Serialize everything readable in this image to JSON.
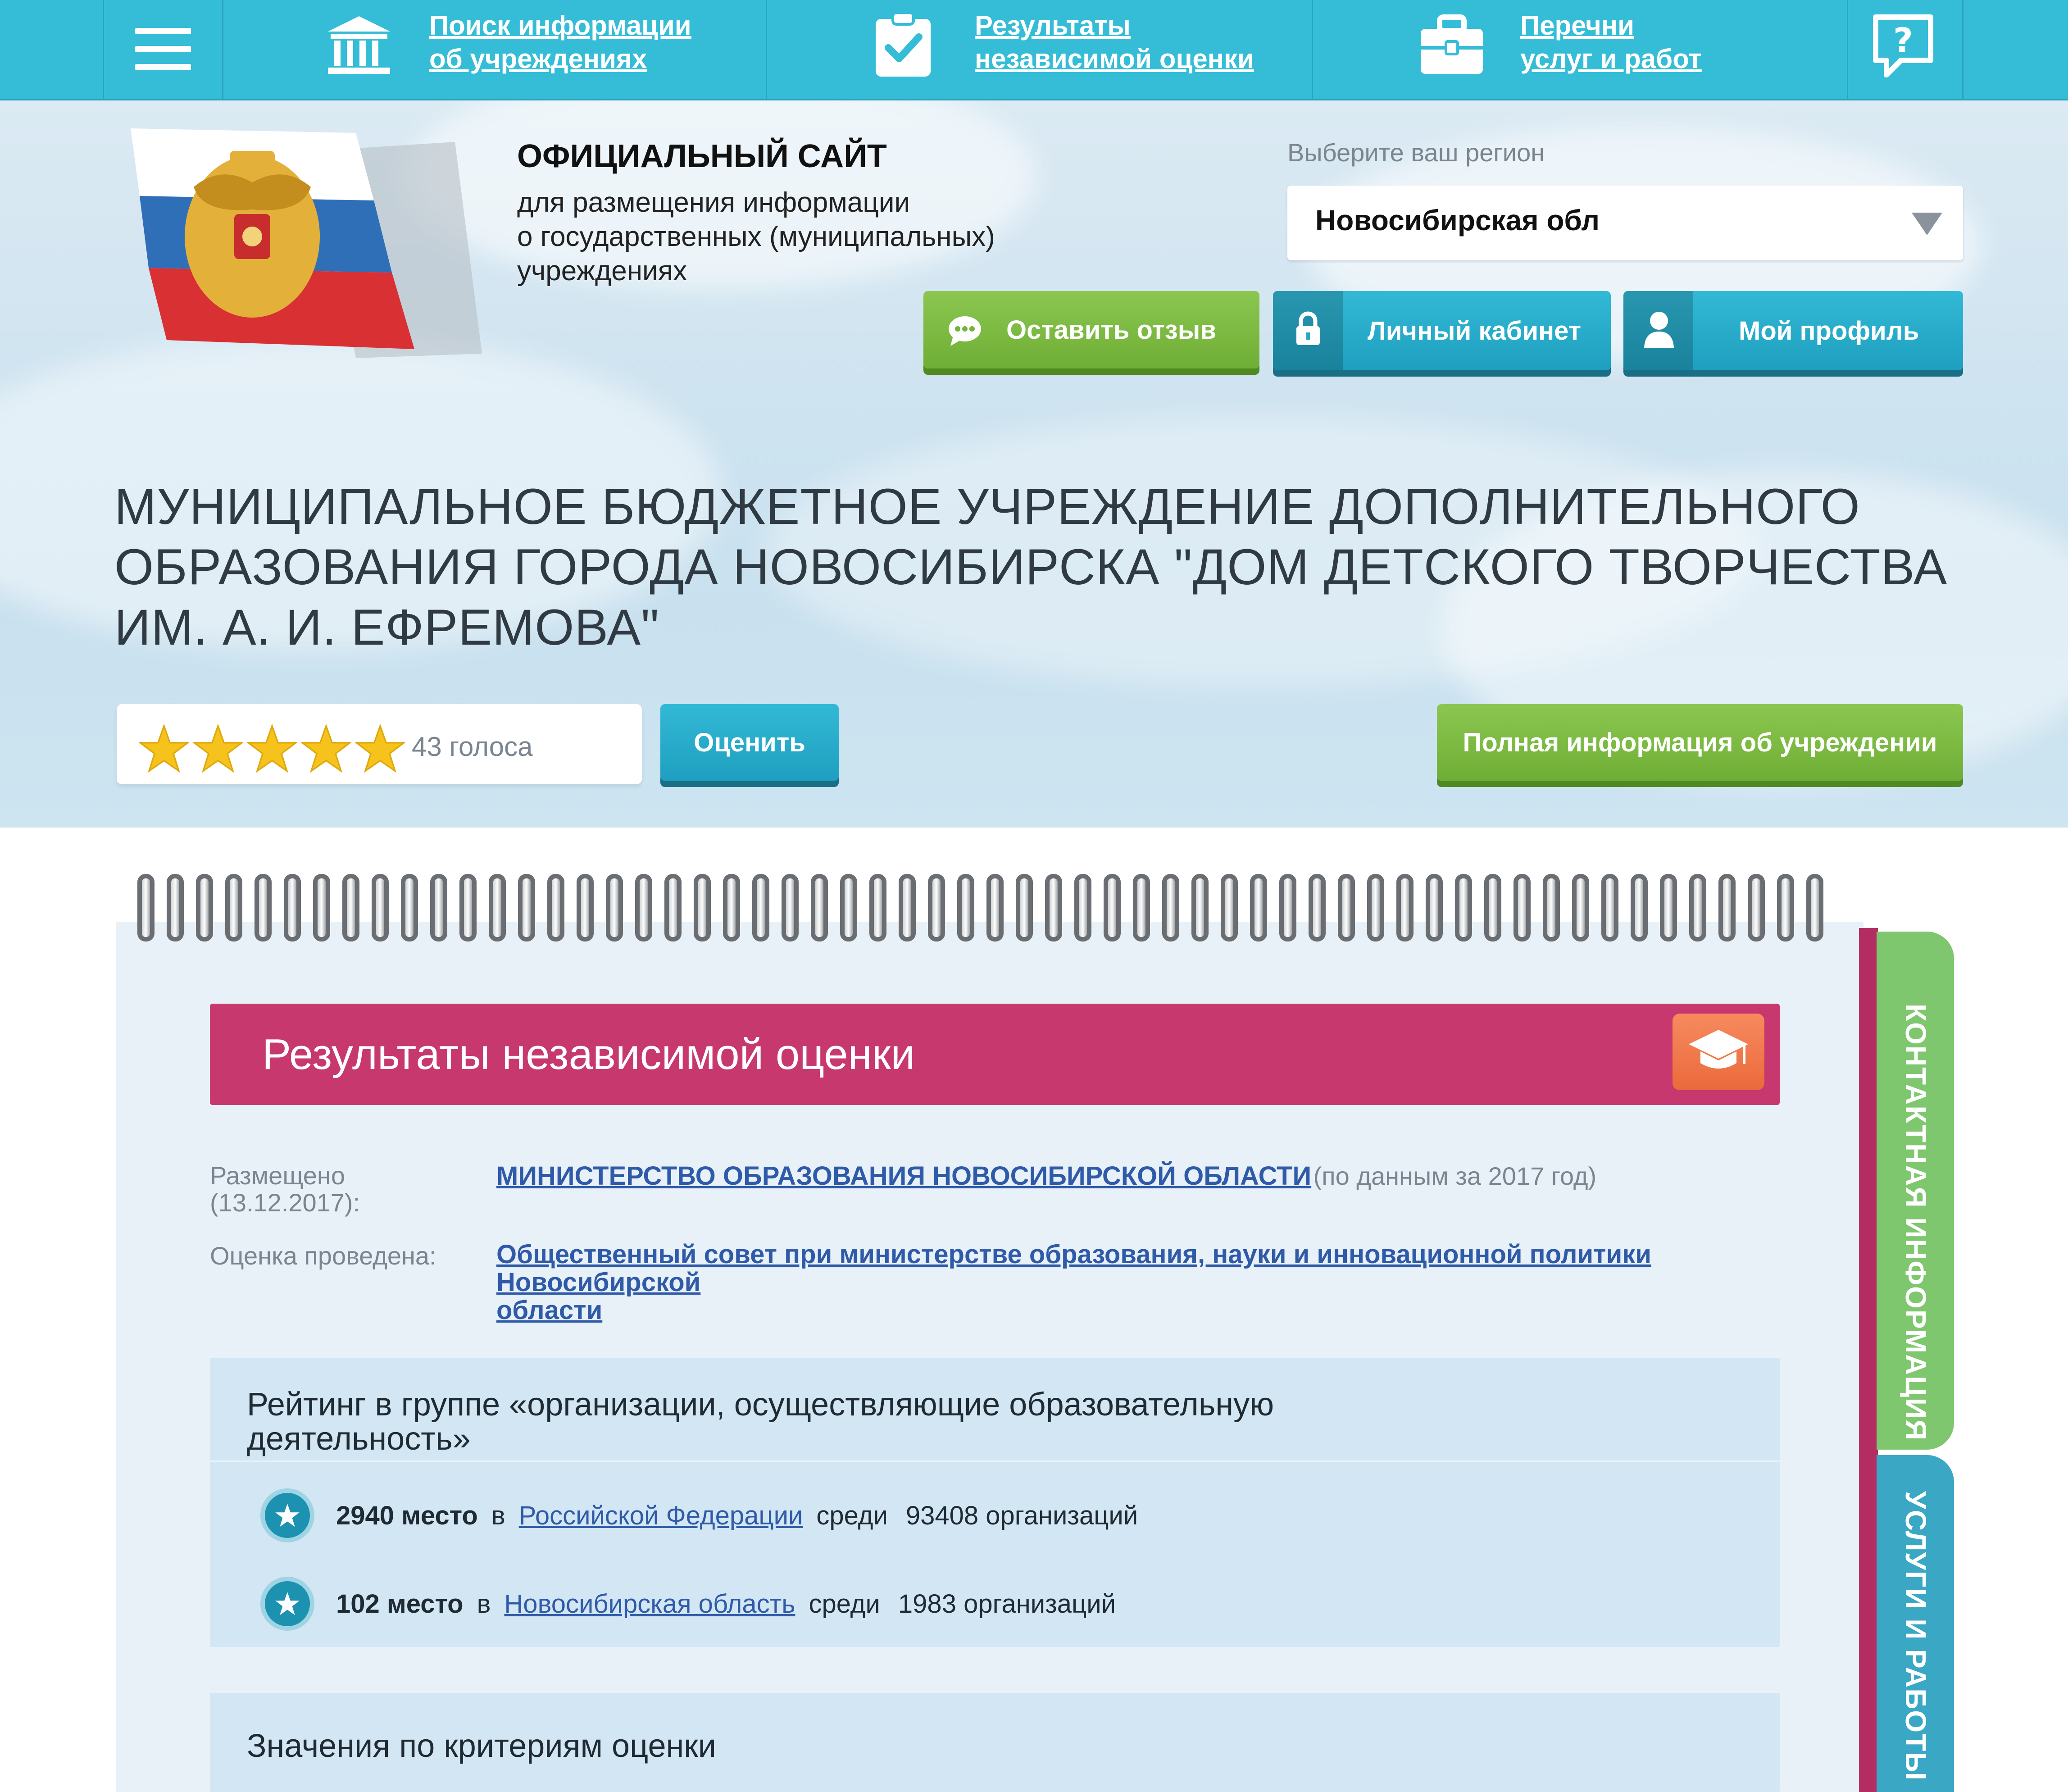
{
  "nav": {
    "search_line1": "Поиск информации",
    "search_line2": "об учреждениях",
    "results_line1": "Результаты",
    "results_line2": "независимой оценки",
    "lists_line1": "Перечни",
    "lists_line2": "услуг и работ",
    "icons": [
      "menu-icon",
      "institution-icon",
      "checklist-icon",
      "briefcase-icon",
      "help-chat-icon"
    ]
  },
  "header": {
    "site_title": "ОФИЦИАЛЬНЫЙ САЙТ",
    "site_sub_line1": "для размещения информации",
    "site_sub_line2": "о государственных (муниципальных)",
    "site_sub_line3": "учреждениях",
    "region_label": "Выберите ваш регион",
    "region_value": "Новосибирская обл",
    "feedback_button": "Оставить отзыв",
    "cabinet_button": "Личный кабинет",
    "profile_button": "Мой профиль"
  },
  "org": {
    "title_line1": "МУНИЦИПАЛЬНОЕ БЮДЖЕТНОЕ УЧРЕЖДЕНИЕ ДОПОЛНИТЕЛЬНОГО",
    "title_line2": "ОБРАЗОВАНИЯ ГОРОДА НОВОСИБИРСКА \"ДОМ ДЕТСКОГО ТВОРЧЕСТВА",
    "title_line3": "ИМ. А. И. ЕФРЕМОВА\"",
    "stars_filled": 5,
    "stars_total": 5,
    "votes": "43 голоса",
    "rate_button": "Оценить",
    "full_info_button": "Полная информация об учреждении"
  },
  "results": {
    "title": "Результаты независимой оценки",
    "posted_label_line1": "Размещено",
    "posted_label_line2": "(13.12.2017):",
    "posted_link": "МИНИСТЕРСТВО ОБРАЗОВАНИЯ НОВОСИБИРСКОЙ ОБЛАСТИ",
    "posted_note": "(по данным за 2017 год)",
    "assessed_label": "Оценка проведена:",
    "assessed_link_line1": "Общественный совет при министерстве образования, науки и инновационной политики Новосибирской",
    "assessed_link_line2": "области"
  },
  "rating": {
    "title_line1": "Рейтинг в группе «организации, осуществляющие образовательную",
    "title_line2": "деятельность»",
    "rows": [
      {
        "place": "2940 место",
        "in": "в",
        "region": "Российской Федерации",
        "among": "среди",
        "count": "93408 организаций"
      },
      {
        "place": "102 место",
        "in": "в",
        "region": "Новосибирская область",
        "among": "среди",
        "count": "1983 организаций"
      }
    ]
  },
  "criteria": {
    "title": "Значения по критериям оценки"
  },
  "side_tabs": {
    "contact": "КОНТАКТНАЯ ИНФОРМАЦИЯ",
    "services": "УСЛУГИ И РАБОТЫ"
  }
}
